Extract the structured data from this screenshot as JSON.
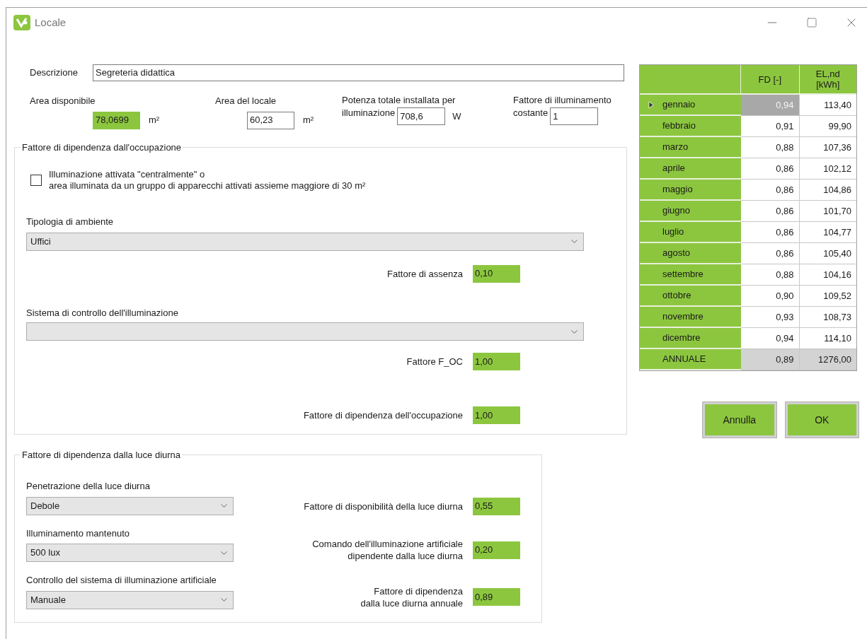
{
  "window": {
    "title": "Locale"
  },
  "description": {
    "label": "Descrizione",
    "value": "Segreteria didattica"
  },
  "fields": [
    {
      "kind": "stacked",
      "label": "Area disponibile",
      "value": "78,0699",
      "unit": "m²",
      "readonly": true
    },
    {
      "kind": "stacked",
      "label": "Area del locale",
      "value": "60,23",
      "unit": "m²",
      "readonly": false
    },
    {
      "kind": "inline",
      "label_lines": [
        "Potenza totale installata per",
        "illuminazione"
      ],
      "value": "708,6",
      "unit": "W",
      "readonly": false
    },
    {
      "kind": "inline",
      "label_lines": [
        "Fattore di illuminamento",
        "costante"
      ],
      "value": "1",
      "readonly": false
    }
  ],
  "occupancy": {
    "title": "Fattore di dipendenza dall'occupazione",
    "checkbox": {
      "label": "Illuminazione attivata \"centralmente\" o\narea illuminata da un gruppo di apparecchi attivati assieme maggiore di 30 m²",
      "checked": false
    },
    "type_select": {
      "label": "Tipologia di ambiente",
      "value": "Uffici"
    },
    "absence": {
      "label": "Fattore di assenza",
      "value": "0,10"
    },
    "control_select": {
      "label": "Sistema di controllo dell'illuminazione"
    },
    "foc": {
      "label": "Fattore F_OC",
      "value": "1,00"
    },
    "dependence": {
      "label": "Fattore di dipendenza dell'occupazione",
      "value": "1,00"
    }
  },
  "daylight": {
    "title": "Fattore di dipendenza dalla luce diurna",
    "rows": [
      {
        "select": {
          "label": "Penetrazione della luce diurna",
          "value": "Debole"
        },
        "factor": {
          "label": "Fattore di disponibilità della luce diurna",
          "value": "0,55"
        }
      },
      {
        "select": {
          "label": "Illuminamento mantenuto",
          "value": "500 lux"
        },
        "factor": {
          "label": "Comando dell'illuminazione artificiale\ndipendente dalla luce diurna",
          "value": "0,20"
        }
      },
      {
        "select": {
          "label": "Controllo del sistema di illuminazione artificiale",
          "value": "Manuale"
        },
        "factor": {
          "label": "Fattore di dipendenza\ndalla luce diurna annuale",
          "value": "0,89"
        }
      }
    ]
  },
  "table": {
    "columns": [
      {
        "label": "FD [-]"
      },
      {
        "label": "EL,nd\n[kWh]"
      }
    ],
    "rows": [
      {
        "kind": "month",
        "month": "gennaio",
        "fd": "0,94",
        "el": "113,40",
        "selected": true
      },
      {
        "kind": "month",
        "month": "febbraio",
        "fd": "0,91",
        "el": "99,90",
        "selected": false
      },
      {
        "kind": "month",
        "month": "marzo",
        "fd": "0,88",
        "el": "107,36",
        "selected": false
      },
      {
        "kind": "month",
        "month": "aprile",
        "fd": "0,86",
        "el": "102,12",
        "selected": false
      },
      {
        "kind": "month",
        "month": "maggio",
        "fd": "0,86",
        "el": "104,86",
        "selected": false
      },
      {
        "kind": "month",
        "month": "giugno",
        "fd": "0,86",
        "el": "101,70",
        "selected": false
      },
      {
        "kind": "month",
        "month": "luglio",
        "fd": "0,86",
        "el": "104,77",
        "selected": false
      },
      {
        "kind": "month",
        "month": "agosto",
        "fd": "0,86",
        "el": "105,40",
        "selected": false
      },
      {
        "kind": "month",
        "month": "settembre",
        "fd": "0,88",
        "el": "104,16",
        "selected": false
      },
      {
        "kind": "month",
        "month": "ottobre",
        "fd": "0,90",
        "el": "109,52",
        "selected": false
      },
      {
        "kind": "month",
        "month": "novembre",
        "fd": "0,93",
        "el": "108,73",
        "selected": false
      },
      {
        "kind": "month",
        "month": "dicembre",
        "fd": "0,94",
        "el": "114,10",
        "selected": false
      },
      {
        "kind": "total",
        "month": "ANNUALE",
        "fd": "0,89",
        "el": "1276,00",
        "selected": false
      }
    ]
  },
  "buttons": [
    {
      "label": "Annulla"
    },
    {
      "label": "OK"
    }
  ]
}
